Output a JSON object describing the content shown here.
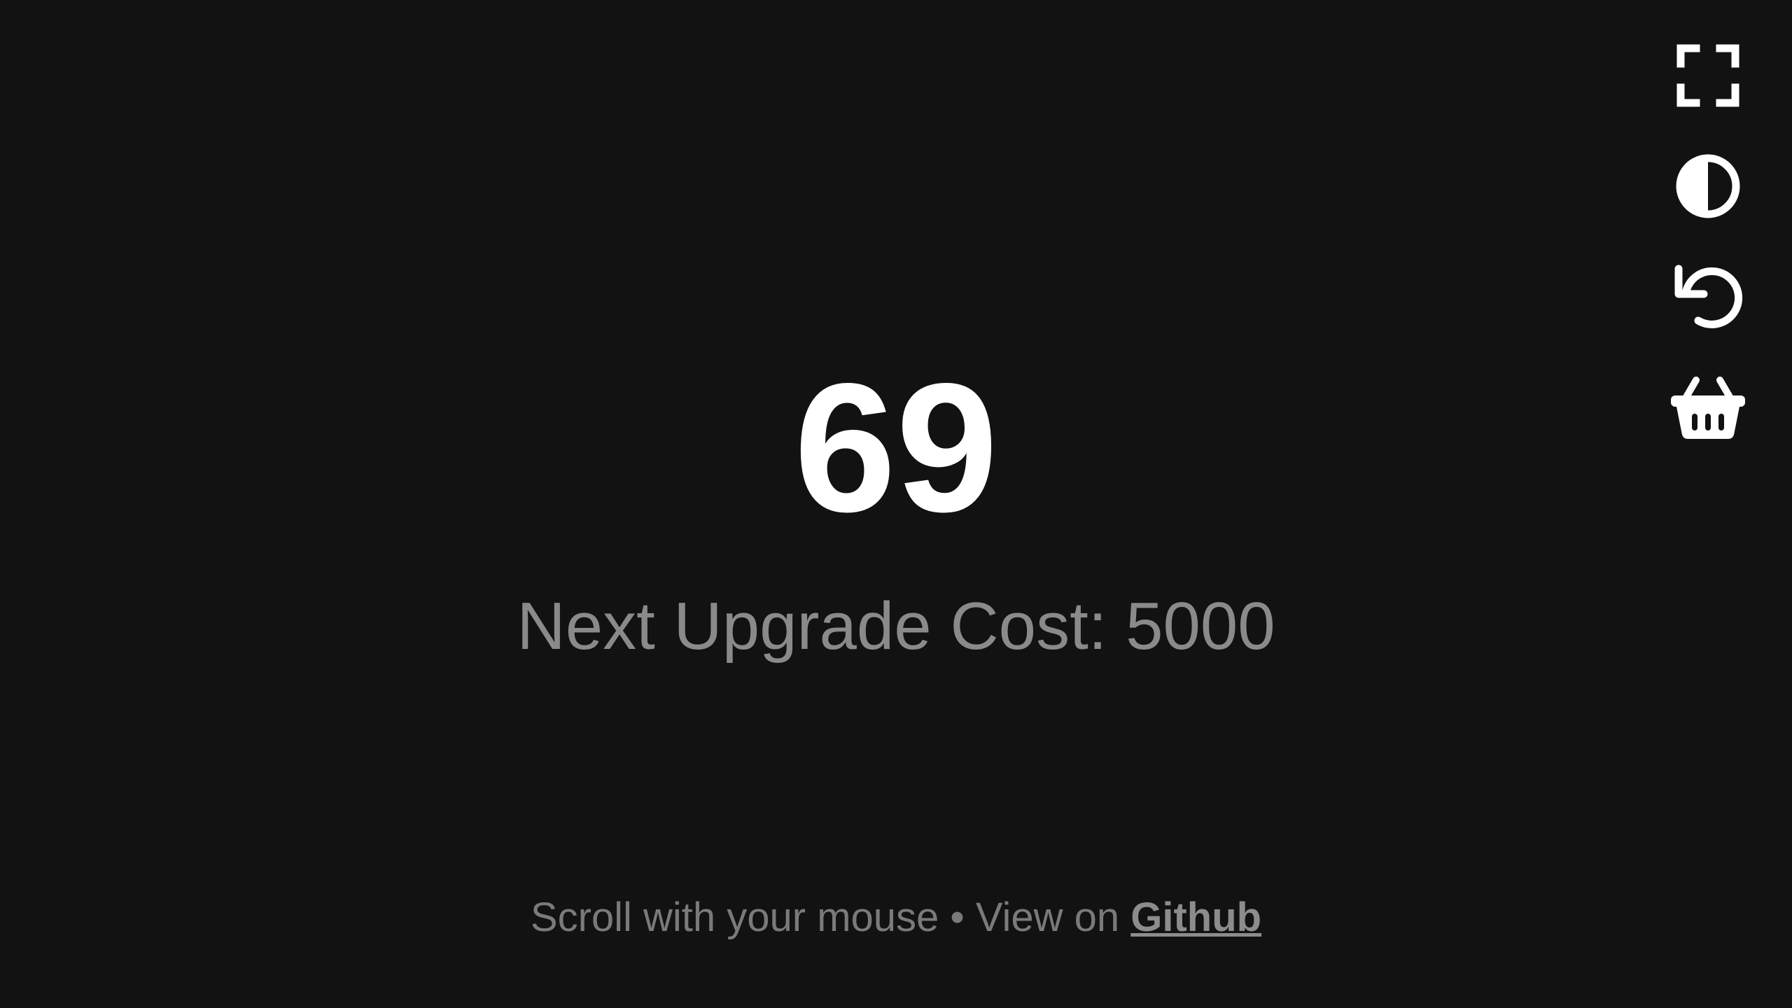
{
  "toolbar": {
    "items": [
      {
        "icon": "fullscreen-icon"
      },
      {
        "icon": "contrast-icon"
      },
      {
        "icon": "reset-icon"
      },
      {
        "icon": "shop-basket-icon"
      }
    ]
  },
  "counter": {
    "value": "69"
  },
  "upgrade": {
    "label": "Next Upgrade Cost: 5000"
  },
  "footer": {
    "text": "Scroll with your mouse • View on ",
    "link_label": "Github"
  },
  "colors": {
    "background": "#121212",
    "counter": "#ffffff",
    "secondary_text": "#8a8a8a"
  }
}
